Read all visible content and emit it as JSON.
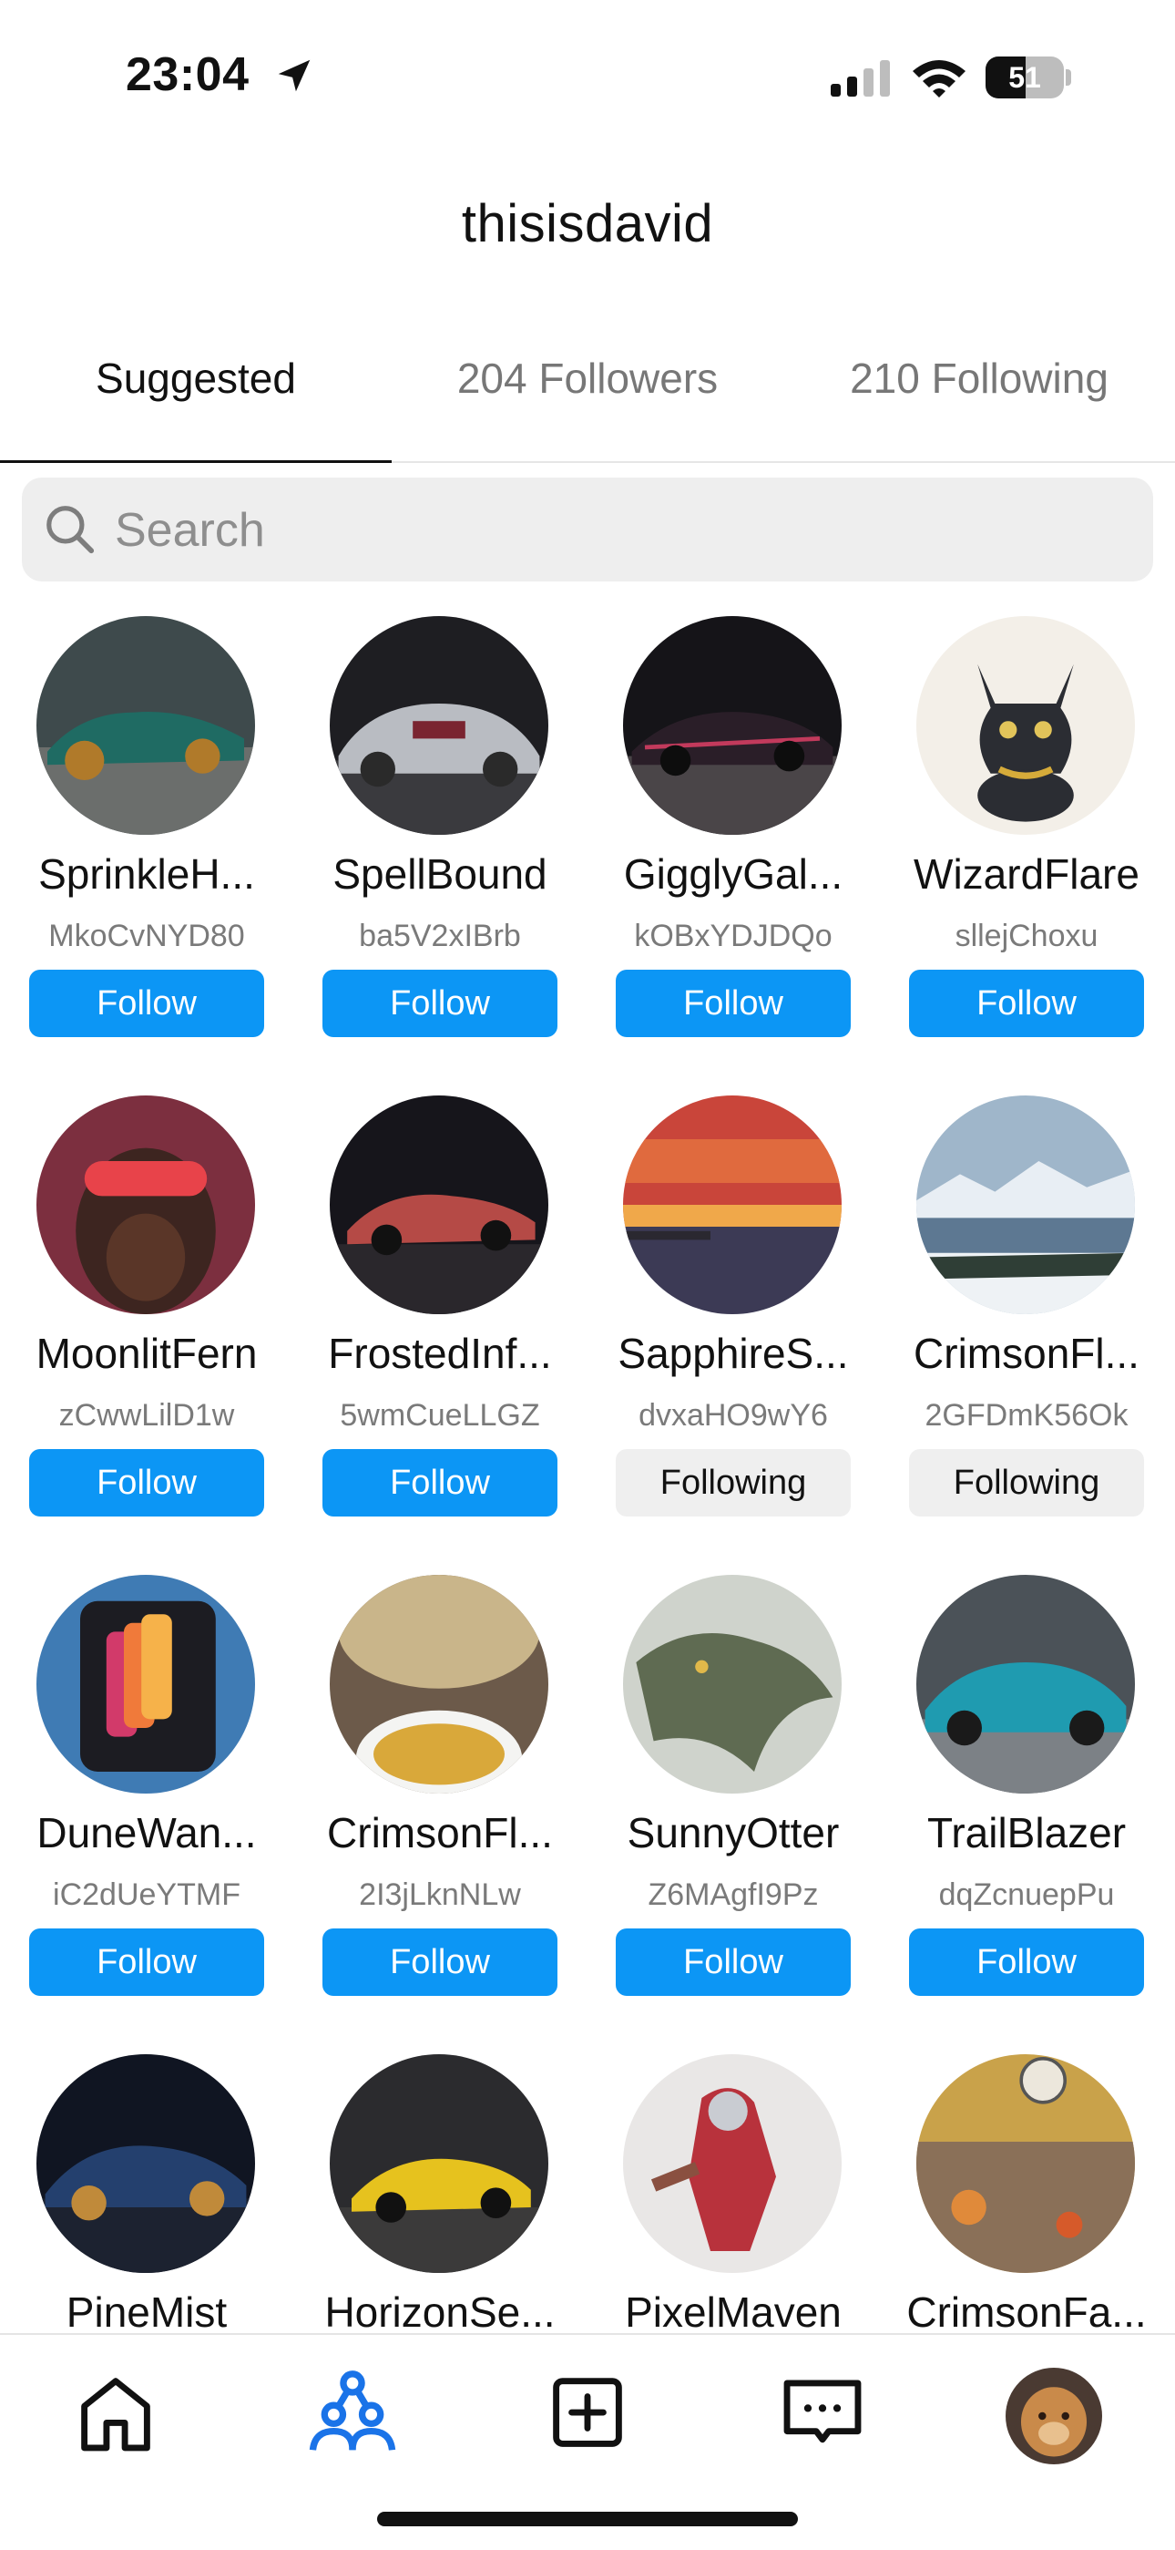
{
  "status_bar": {
    "time": "23:04",
    "battery": "51",
    "battery_level": 0.51
  },
  "header": {
    "title": "thisisdavid"
  },
  "tabs": [
    {
      "label": "Suggested",
      "active": true
    },
    {
      "label": "204 Followers",
      "active": false
    },
    {
      "label": "210 Following",
      "active": false
    }
  ],
  "search": {
    "placeholder": "Search",
    "value": ""
  },
  "users": [
    {
      "name": "SprinkleH...",
      "handle": "MkoCvNYD80",
      "button": "Follow"
    },
    {
      "name": "SpellBound",
      "handle": "ba5V2xIBrb",
      "button": "Follow"
    },
    {
      "name": "GigglyGal...",
      "handle": "kOBxYDJDQo",
      "button": "Follow"
    },
    {
      "name": "WizardFlare",
      "handle": "sllejChoxu",
      "button": "Follow"
    },
    {
      "name": "MoonlitFern",
      "handle": "zCwwLilD1w",
      "button": "Follow"
    },
    {
      "name": "FrostedInf...",
      "handle": "5wmCueLLGZ",
      "button": "Follow"
    },
    {
      "name": "SapphireS...",
      "handle": "dvxaHO9wY6",
      "button": "Following"
    },
    {
      "name": "CrimsonFl...",
      "handle": "2GFDmK56Ok",
      "button": "Following"
    },
    {
      "name": "DuneWan...",
      "handle": "iC2dUeYTMF",
      "button": "Follow"
    },
    {
      "name": "CrimsonFl...",
      "handle": "2I3jLknNLw",
      "button": "Follow"
    },
    {
      "name": "SunnyOtter",
      "handle": "Z6MAgfI9Pz",
      "button": "Follow"
    },
    {
      "name": "TrailBlazer",
      "handle": "dqZcnuepPu",
      "button": "Follow"
    },
    {
      "name": "PineMist",
      "handle": "",
      "button": ""
    },
    {
      "name": "HorizonSe...",
      "handle": "",
      "button": ""
    },
    {
      "name": "PixelMaven",
      "handle": "",
      "button": ""
    },
    {
      "name": "CrimsonFa...",
      "handle": "",
      "button": ""
    }
  ],
  "nav": [
    {
      "icon": "home-icon"
    },
    {
      "icon": "network-icon",
      "active": true
    },
    {
      "icon": "add-post-icon"
    },
    {
      "icon": "messages-icon"
    },
    {
      "icon": "profile-avatar"
    }
  ],
  "colors": {
    "accent": "#0c96f5",
    "following_bg": "#efefef",
    "active_nav": "#1a73e8"
  }
}
